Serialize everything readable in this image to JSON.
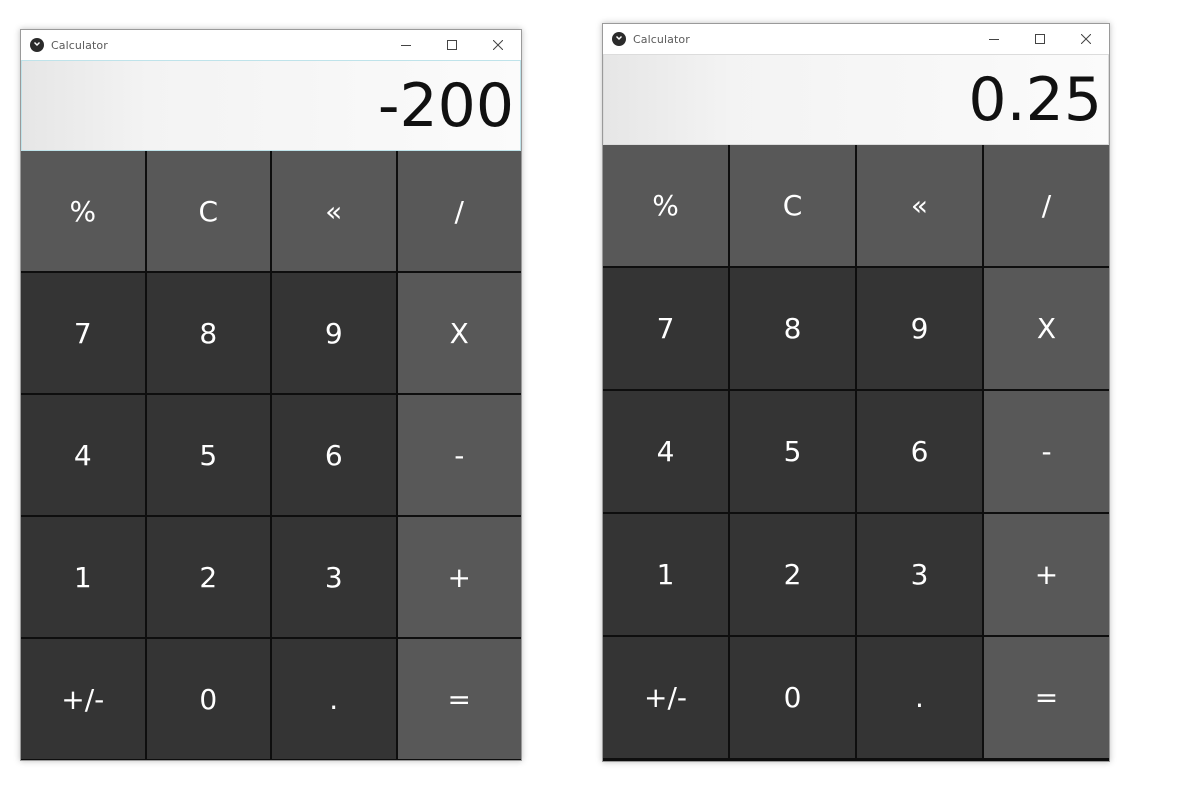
{
  "windows": [
    {
      "title": "Calculator",
      "display": "-200",
      "keys": [
        {
          "label": "%",
          "kind": "func"
        },
        {
          "label": "C",
          "kind": "func"
        },
        {
          "label": "«",
          "kind": "func"
        },
        {
          "label": "/",
          "kind": "func"
        },
        {
          "label": "7",
          "kind": "num"
        },
        {
          "label": "8",
          "kind": "num"
        },
        {
          "label": "9",
          "kind": "num"
        },
        {
          "label": "X",
          "kind": "op"
        },
        {
          "label": "4",
          "kind": "num"
        },
        {
          "label": "5",
          "kind": "num"
        },
        {
          "label": "6",
          "kind": "num"
        },
        {
          "label": "-",
          "kind": "op"
        },
        {
          "label": "1",
          "kind": "num"
        },
        {
          "label": "2",
          "kind": "num"
        },
        {
          "label": "3",
          "kind": "num"
        },
        {
          "label": "+",
          "kind": "op"
        },
        {
          "label": "+/-",
          "kind": "num"
        },
        {
          "label": "0",
          "kind": "num"
        },
        {
          "label": ".",
          "kind": "num"
        },
        {
          "label": "=",
          "kind": "op"
        }
      ]
    },
    {
      "title": "Calculator",
      "display": "0.25",
      "keys": [
        {
          "label": "%",
          "kind": "func"
        },
        {
          "label": "C",
          "kind": "func"
        },
        {
          "label": "«",
          "kind": "func"
        },
        {
          "label": "/",
          "kind": "func"
        },
        {
          "label": "7",
          "kind": "num"
        },
        {
          "label": "8",
          "kind": "num"
        },
        {
          "label": "9",
          "kind": "num"
        },
        {
          "label": "X",
          "kind": "op"
        },
        {
          "label": "4",
          "kind": "num"
        },
        {
          "label": "5",
          "kind": "num"
        },
        {
          "label": "6",
          "kind": "num"
        },
        {
          "label": "-",
          "kind": "op"
        },
        {
          "label": "1",
          "kind": "num"
        },
        {
          "label": "2",
          "kind": "num"
        },
        {
          "label": "3",
          "kind": "num"
        },
        {
          "label": "+",
          "kind": "op"
        },
        {
          "label": "+/-",
          "kind": "num"
        },
        {
          "label": "0",
          "kind": "num"
        },
        {
          "label": ".",
          "kind": "num"
        },
        {
          "label": "=",
          "kind": "op"
        }
      ]
    }
  ],
  "colors": {
    "function_key": "#585858",
    "number_key": "#343434",
    "operator_key": "#585858",
    "key_text": "#ffffff",
    "display_text": "#111111"
  },
  "icons": {
    "app": "kivy-logo-icon",
    "minimize": "minimize-icon",
    "maximize": "maximize-icon",
    "close": "close-icon"
  }
}
